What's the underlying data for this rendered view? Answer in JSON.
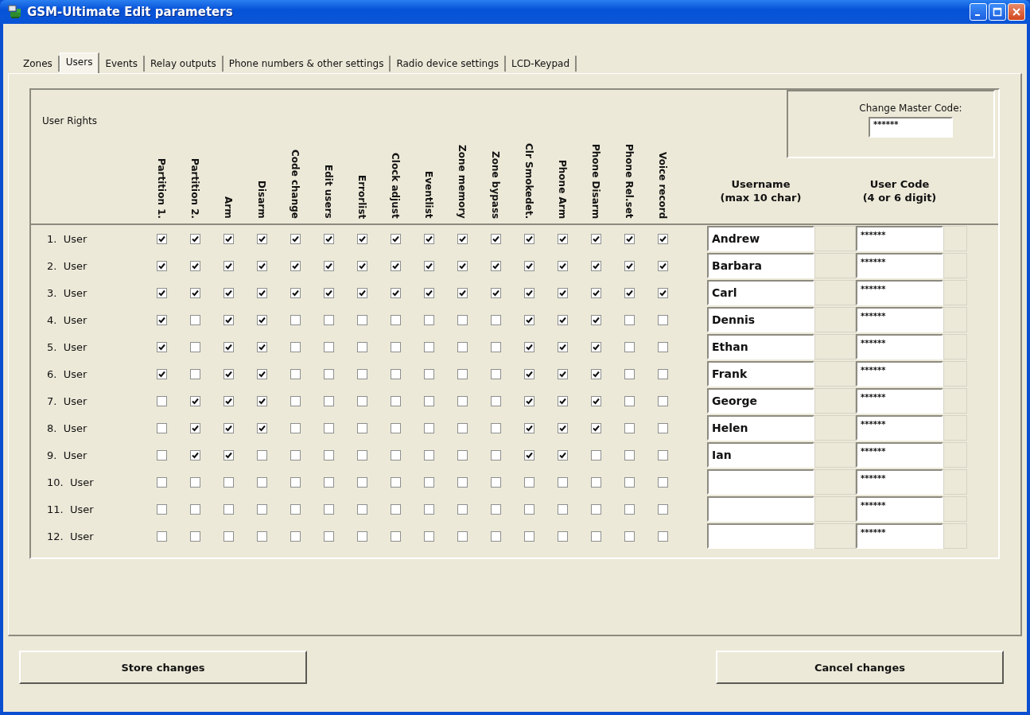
{
  "window": {
    "title": "GSM-Ultimate Edit parameters"
  },
  "tabs": [
    {
      "label": "Zones",
      "selected": false
    },
    {
      "label": "Users",
      "selected": true
    },
    {
      "label": "Events",
      "selected": false
    },
    {
      "label": "Relay outputs",
      "selected": false
    },
    {
      "label": "Phone numbers & other settings",
      "selected": false
    },
    {
      "label": "Radio device settings",
      "selected": false
    },
    {
      "label": "LCD-Keypad",
      "selected": false
    }
  ],
  "user_rights_title": "User Rights",
  "rights_columns": [
    "Partition 1.",
    "Partition 2.",
    "Arm",
    "Disarm",
    "Code change",
    "Edit users",
    "Errorlist",
    "Clock adjust",
    "Eventlist",
    "Zone memory",
    "Zone bypass",
    "Clr Smokedet.",
    "Phone Arm",
    "Phone Disarm",
    "Phone Rel.set",
    "Voice record"
  ],
  "master_code": {
    "label": "Change Master Code:",
    "value": "******"
  },
  "username_header": [
    "Username",
    "(max 10 char)"
  ],
  "code_header": [
    "User Code",
    "(4 or 6 digit)"
  ],
  "users": [
    {
      "label": "1.  User",
      "rights": [
        true,
        true,
        true,
        true,
        true,
        true,
        true,
        true,
        true,
        true,
        true,
        true,
        true,
        true,
        true,
        true
      ],
      "username": "Andrew",
      "code": "******"
    },
    {
      "label": "2.  User",
      "rights": [
        true,
        true,
        true,
        true,
        true,
        true,
        true,
        true,
        true,
        true,
        true,
        true,
        true,
        true,
        true,
        true
      ],
      "username": "Barbara",
      "code": "******"
    },
    {
      "label": "3.  User",
      "rights": [
        true,
        true,
        true,
        true,
        true,
        true,
        true,
        true,
        true,
        true,
        true,
        true,
        true,
        true,
        true,
        true
      ],
      "username": "Carl",
      "code": "******"
    },
    {
      "label": "4.  User",
      "rights": [
        true,
        false,
        true,
        true,
        false,
        false,
        false,
        false,
        false,
        false,
        false,
        true,
        true,
        true,
        false,
        false
      ],
      "username": "Dennis",
      "code": "******"
    },
    {
      "label": "5.  User",
      "rights": [
        true,
        false,
        true,
        true,
        false,
        false,
        false,
        false,
        false,
        false,
        false,
        true,
        true,
        true,
        false,
        false
      ],
      "username": "Ethan",
      "code": "******"
    },
    {
      "label": "6.  User",
      "rights": [
        true,
        false,
        true,
        true,
        false,
        false,
        false,
        false,
        false,
        false,
        false,
        true,
        true,
        true,
        false,
        false
      ],
      "username": "Frank",
      "code": "******"
    },
    {
      "label": "7.  User",
      "rights": [
        false,
        true,
        true,
        true,
        false,
        false,
        false,
        false,
        false,
        false,
        false,
        true,
        true,
        true,
        false,
        false
      ],
      "username": "George",
      "code": "******"
    },
    {
      "label": "8.  User",
      "rights": [
        false,
        true,
        true,
        true,
        false,
        false,
        false,
        false,
        false,
        false,
        false,
        true,
        true,
        true,
        false,
        false
      ],
      "username": "Helen",
      "code": "******"
    },
    {
      "label": "9.  User",
      "rights": [
        false,
        true,
        true,
        false,
        false,
        false,
        false,
        false,
        false,
        false,
        false,
        true,
        true,
        false,
        false,
        false
      ],
      "username": "Ian",
      "code": "******"
    },
    {
      "label": "10.  User",
      "rights": [
        false,
        false,
        false,
        false,
        false,
        false,
        false,
        false,
        false,
        false,
        false,
        false,
        false,
        false,
        false,
        false
      ],
      "code": "******"
    },
    {
      "label": "11.  User",
      "rights": [
        false,
        false,
        false,
        false,
        false,
        false,
        false,
        false,
        false,
        false,
        false,
        false,
        false,
        false,
        false,
        false
      ],
      "code": "******"
    },
    {
      "label": "12.  User",
      "rights": [
        false,
        false,
        false,
        false,
        false,
        false,
        false,
        false,
        false,
        false,
        false,
        false,
        false,
        false,
        false,
        false
      ],
      "code": "******"
    }
  ],
  "buttons": [
    "Store changes",
    "Cancel changes"
  ]
}
